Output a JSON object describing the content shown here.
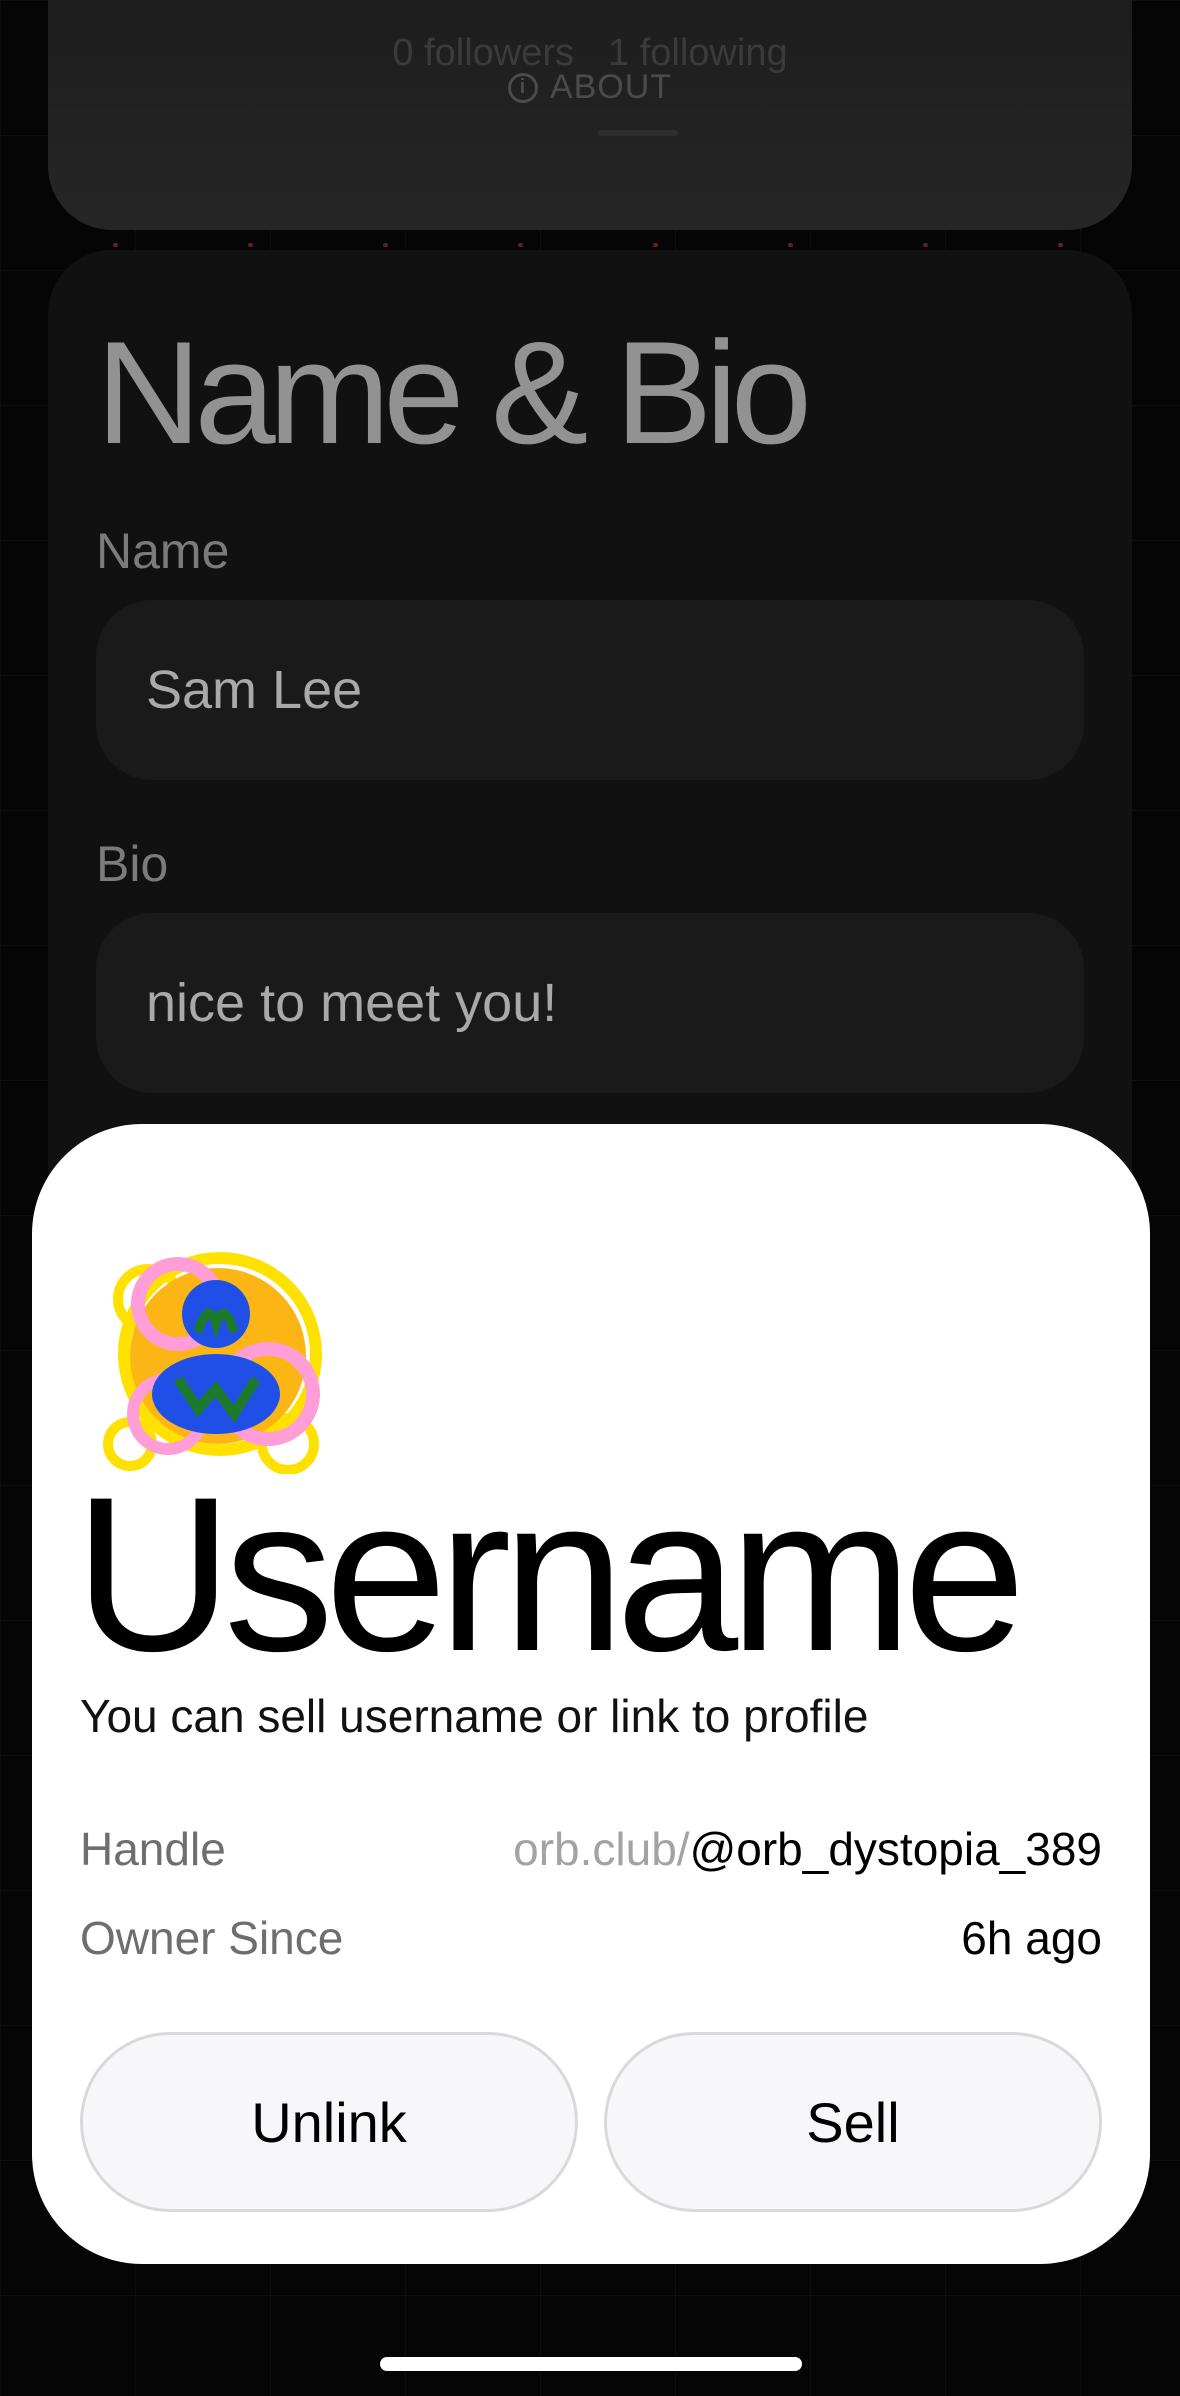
{
  "profile": {
    "followers": "0 followers",
    "following": "1 following",
    "about_label": "ABOUT"
  },
  "name_bio": {
    "title": "Name & Bio",
    "name_label": "Name",
    "name_value": "Sam Lee",
    "bio_label": "Bio",
    "bio_value": "nice to meet you!"
  },
  "username_sheet": {
    "title": "Username",
    "subtitle": "You can sell username or link to profile",
    "handle_label": "Handle",
    "handle_prefix": "orb.club/",
    "handle_value": "@orb_dystopia_389",
    "owner_label": "Owner Since",
    "owner_value": "6h ago",
    "unlink_label": "Unlink",
    "sell_label": "Sell"
  },
  "icons": {
    "about": "info-icon",
    "avatar": "avatar-icon"
  }
}
